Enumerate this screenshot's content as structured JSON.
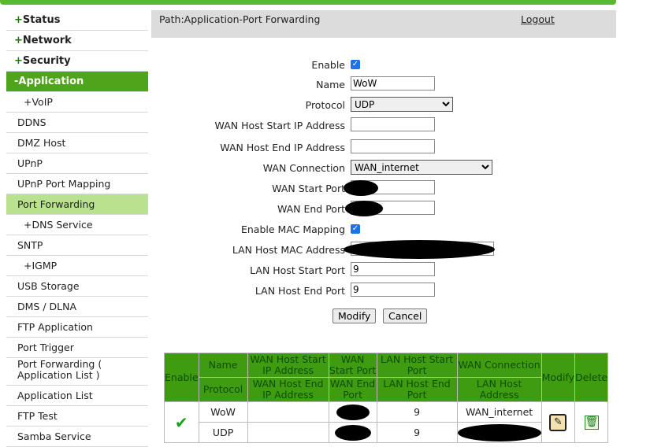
{
  "sidebar": {
    "items": [
      {
        "label": "Status",
        "prefix": "+"
      },
      {
        "label": "Network",
        "prefix": "+"
      },
      {
        "label": "Security",
        "prefix": "+"
      },
      {
        "label": "-Application"
      },
      {
        "label": "+VoIP"
      },
      {
        "label": "DDNS"
      },
      {
        "label": "DMZ Host"
      },
      {
        "label": "UPnP"
      },
      {
        "label": "UPnP Port Mapping"
      },
      {
        "label": "Port Forwarding"
      },
      {
        "label": "+DNS Service"
      },
      {
        "label": "SNTP"
      },
      {
        "label": "+IGMP"
      },
      {
        "label": "USB Storage"
      },
      {
        "label": "DMS / DLNA"
      },
      {
        "label": "FTP Application"
      },
      {
        "label": "Port Trigger"
      },
      {
        "label": "Port Forwarding ( Application List )"
      },
      {
        "label": "Application List"
      },
      {
        "label": "FTP Test"
      },
      {
        "label": "Samba Service"
      }
    ]
  },
  "header": {
    "path": "Path:Application-Port Forwarding",
    "logout": "Logout"
  },
  "form": {
    "enable": {
      "label": "Enable",
      "checked": true
    },
    "name": {
      "label": "Name",
      "value": "WoW"
    },
    "protocol": {
      "label": "Protocol",
      "value": "UDP"
    },
    "wan_start_ip": {
      "label": "WAN Host Start IP Address",
      "value": ""
    },
    "wan_end_ip": {
      "label": "WAN Host End IP Address",
      "value": ""
    },
    "wan_connection": {
      "label": "WAN Connection",
      "value": "WAN_internet"
    },
    "wan_start_port": {
      "label": "WAN Start Port"
    },
    "wan_end_port": {
      "label": "WAN End Port"
    },
    "mac_mapping": {
      "label": "Enable MAC Mapping",
      "checked": true
    },
    "lan_mac": {
      "label": "LAN Host MAC Address"
    },
    "lan_start_port": {
      "label": "LAN Host Start Port",
      "value": "9"
    },
    "lan_end_port": {
      "label": "LAN Host End Port",
      "value": "9"
    },
    "modify": "Modify",
    "cancel": "Cancel"
  },
  "table": {
    "h": {
      "enable": "Enable",
      "name": "Name",
      "protocol": "Protocol",
      "wan_start_ip": "WAN Host Start IP Address",
      "wan_end_ip": "WAN Host End IP Address",
      "wan_start_port": "WAN Start Port",
      "wan_end_port": "WAN End Port",
      "lan_start": "LAN Host Start Port",
      "lan_end": "LAN Host End Port",
      "wan_conn": "WAN Connection",
      "lan_addr": "LAN Host Address",
      "modify": "Modify",
      "delete": "Delete"
    },
    "row": {
      "enabled": true,
      "name": "WoW",
      "protocol": "UDP",
      "lan_start": "9",
      "lan_end": "9",
      "wan_conn": "WAN_internet"
    }
  }
}
